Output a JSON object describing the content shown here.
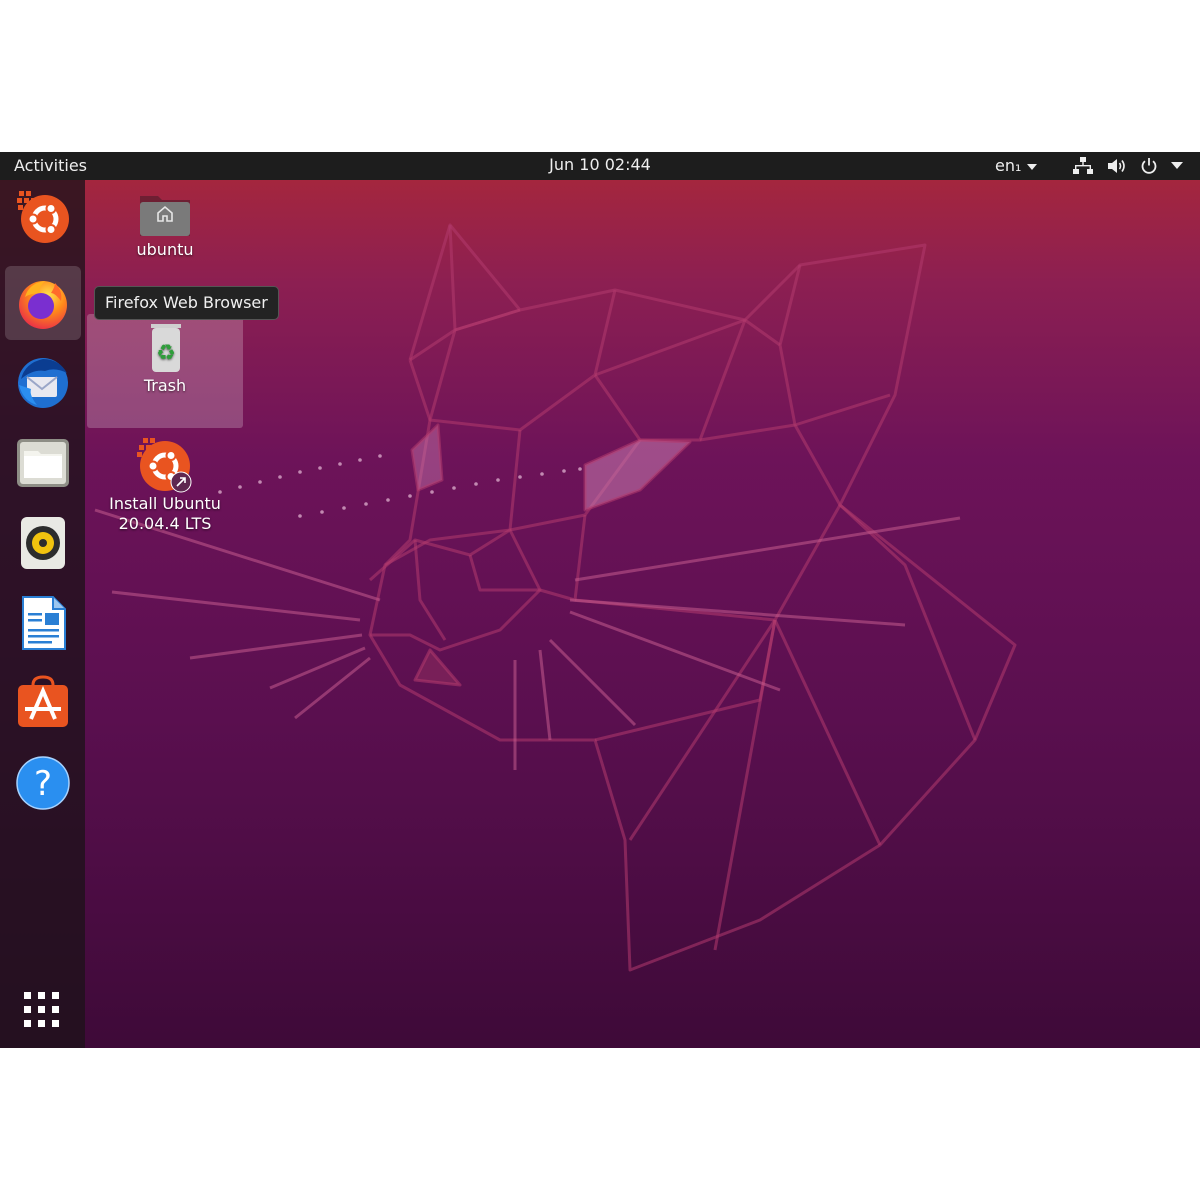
{
  "topbar": {
    "activities": "Activities",
    "datetime": "Jun 10  02:44",
    "language": "en₁",
    "icons": [
      "network-icon",
      "volume-icon",
      "power-icon",
      "system-menu-caret-icon"
    ]
  },
  "dock": {
    "items": [
      {
        "name": "Install Ubuntu",
        "icon": "ubuntu-installer-icon"
      },
      {
        "name": "Firefox Web Browser",
        "icon": "firefox-icon",
        "active": true
      },
      {
        "name": "Thunderbird Mail",
        "icon": "thunderbird-icon"
      },
      {
        "name": "Files",
        "icon": "files-icon"
      },
      {
        "name": "Rhythmbox",
        "icon": "rhythmbox-icon"
      },
      {
        "name": "LibreOffice Writer",
        "icon": "writer-icon"
      },
      {
        "name": "Ubuntu Software",
        "icon": "software-icon"
      },
      {
        "name": "Help",
        "icon": "help-icon"
      }
    ],
    "show_apps_icon": "app-grid-icon"
  },
  "tooltip": "Firefox Web Browser",
  "desktop_icons": {
    "home": "ubuntu",
    "trash": "Trash",
    "installer_line1": "Install Ubuntu",
    "installer_line2": "20.04.4 LTS"
  },
  "colors": {
    "topbar": "#1d1d1d",
    "ubuntu_orange": "#e95420",
    "wallpaper_top": "#a4263e",
    "wallpaper_bottom": "#3e0a38"
  }
}
